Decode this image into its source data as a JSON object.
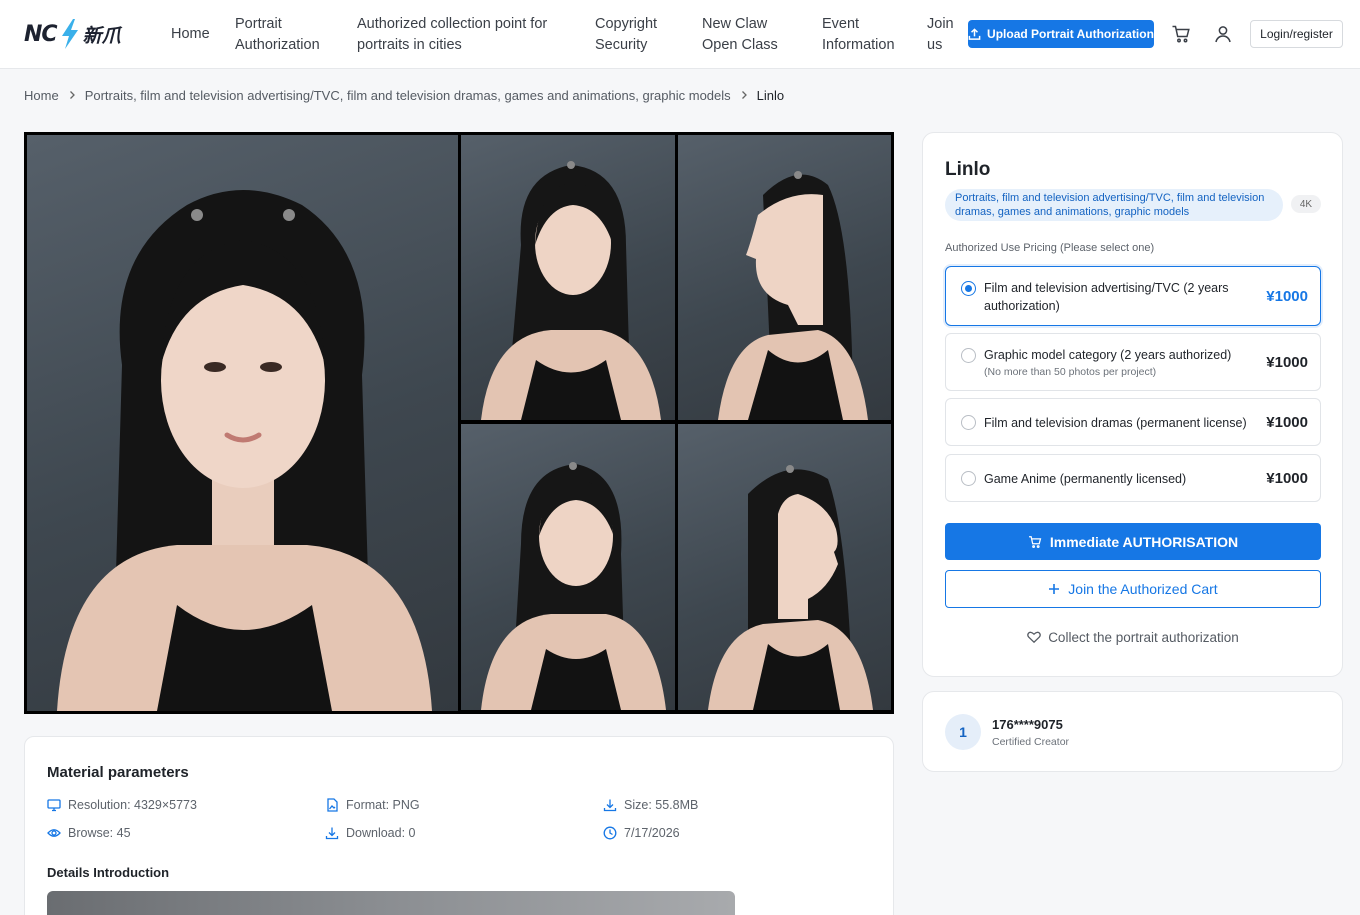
{
  "brand": {
    "logo_text": "NC",
    "logo_cn": "新爪",
    "accent": "#1677e5"
  },
  "nav": [
    {
      "label": "Home"
    },
    {
      "label": "Portrait\nAuthorization"
    },
    {
      "label": "Authorized collection point for\nportraits in cities"
    },
    {
      "label": "Copyright\nSecurity"
    },
    {
      "label": "New Claw\nOpen Class"
    },
    {
      "label": "Event\nInformation"
    },
    {
      "label": "Join\nus"
    }
  ],
  "header": {
    "upload_label": "Upload Portrait Authorization",
    "login_label": "Login/register",
    "icons": [
      "upload-icon",
      "cart-icon",
      "user-icon"
    ]
  },
  "breadcrumb": [
    "Home",
    "Portraits, film and television advertising/TVC, film and television dramas, games and animations, graphic models",
    "Linlo"
  ],
  "product": {
    "title": "Linlo",
    "category_tag": "Portraits, film and television advertising/TVC, film and television dramas, games and animations, graphic models",
    "resolution_badge": "4K",
    "pricing_label": "Authorized Use Pricing (Please select one)",
    "options": [
      {
        "label": "Film and television advertising/TVC (2 years authorization)",
        "sub": "",
        "price": "¥1000",
        "selected": true
      },
      {
        "label": "Graphic model category (2 years authorized)",
        "sub": "(No more than 50 photos per project)",
        "price": "¥1000",
        "selected": false
      },
      {
        "label": "Film and television dramas (permanent license)",
        "sub": "",
        "price": "¥1000",
        "selected": false
      },
      {
        "label": "Game Anime (permanently licensed)",
        "sub": "",
        "price": "¥1000",
        "selected": false
      }
    ],
    "buy_label": "Immediate AUTHORISATION",
    "cart_label": "Join the Authorized Cart",
    "collect_label": "Collect the portrait authorization"
  },
  "creator": {
    "rank": "1",
    "name": "176****9075",
    "role": "Certified Creator"
  },
  "params": {
    "title": "Material parameters",
    "resolution": "Resolution: 4329×5773",
    "format": "Format: PNG",
    "size": "Size: 55.8MB",
    "browse": "Browse: 45",
    "download": "Download: 0",
    "date": "7/17/2026",
    "details_title": "Details Introduction"
  }
}
